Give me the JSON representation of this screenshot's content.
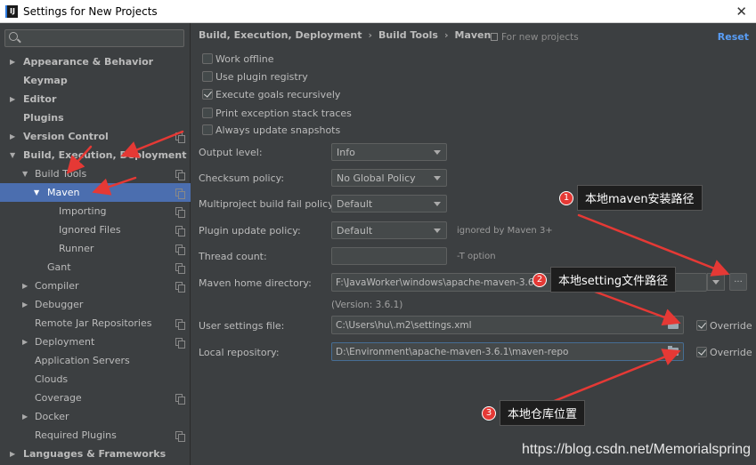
{
  "window": {
    "title": "Settings for New Projects",
    "close_glyph": "✕"
  },
  "search": {
    "placeholder": "Q-"
  },
  "sidebar": {
    "items": [
      {
        "label": "Appearance & Behavior"
      },
      {
        "label": "Keymap"
      },
      {
        "label": "Editor"
      },
      {
        "label": "Plugins"
      },
      {
        "label": "Version Control"
      },
      {
        "label": "Build, Execution, Deployment"
      },
      {
        "label": "Build Tools"
      },
      {
        "label": "Maven"
      },
      {
        "label": "Importing"
      },
      {
        "label": "Ignored Files"
      },
      {
        "label": "Runner"
      },
      {
        "label": "Gant"
      },
      {
        "label": "Compiler"
      },
      {
        "label": "Debugger"
      },
      {
        "label": "Remote Jar Repositories"
      },
      {
        "label": "Deployment"
      },
      {
        "label": "Application Servers"
      },
      {
        "label": "Clouds"
      },
      {
        "label": "Coverage"
      },
      {
        "label": "Docker"
      },
      {
        "label": "Required Plugins"
      },
      {
        "label": "Languages & Frameworks"
      }
    ]
  },
  "breadcrumb": {
    "part1": "Build, Execution, Deployment",
    "part2": "Build Tools",
    "part3": "Maven",
    "separator": "›"
  },
  "scope_note": "For new projects",
  "reset_label": "Reset",
  "checkboxes": [
    {
      "label": "Work offline",
      "checked": false
    },
    {
      "label": "Use plugin registry",
      "checked": false
    },
    {
      "label": "Execute goals recursively",
      "checked": true
    },
    {
      "label": "Print exception stack traces",
      "checked": false
    },
    {
      "label": "Always update snapshots",
      "checked": false
    }
  ],
  "form": {
    "output_level": {
      "label": "Output level:",
      "value": "Info"
    },
    "checksum_policy": {
      "label": "Checksum policy:",
      "value": "No Global Policy"
    },
    "fail_policy": {
      "label": "Multiproject build fail policy:",
      "value": "Default"
    },
    "plugin_update_policy": {
      "label": "Plugin update policy:",
      "value": "Default",
      "hint": "ignored by Maven 3+"
    },
    "thread_count": {
      "label": "Thread count:",
      "value": "",
      "hint": "-T option"
    },
    "maven_home": {
      "label": "Maven home directory:",
      "value": "F:\\JavaWorker\\windows\\apache-maven-3.6.1",
      "version": "(Version: 3.6.1)",
      "browse_label": "..."
    },
    "user_settings": {
      "label": "User settings file:",
      "value": "C:\\Users\\hu\\.m2\\settings.xml",
      "override_label": "Override",
      "override_checked": true
    },
    "local_repo": {
      "label": "Local repository:",
      "value": "D:\\Environment\\apache-maven-3.6.1\\maven-repo",
      "override_label": "Override",
      "override_checked": true
    }
  },
  "annotations": [
    {
      "num": "1",
      "text": "本地maven安装路径"
    },
    {
      "num": "2",
      "text": "本地setting文件路径"
    },
    {
      "num": "3",
      "text": "本地仓库位置"
    }
  ],
  "watermark": "https://blog.csdn.net/Memorialspring",
  "colors": {
    "selection": "#4b6eaf",
    "link": "#589df6",
    "annotation_red": "#e53935"
  }
}
